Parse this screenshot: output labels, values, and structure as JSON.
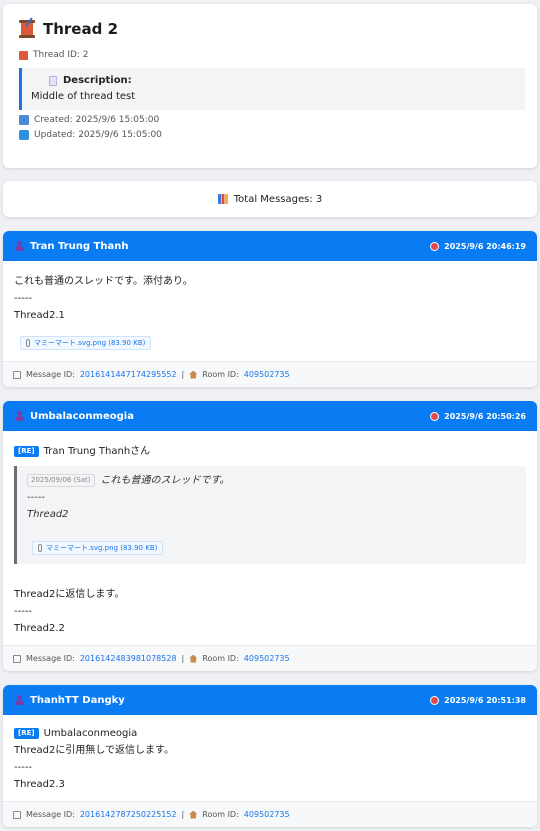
{
  "thread": {
    "title": "Thread 2",
    "id_label": "Thread ID: 2",
    "description_label": "Description:",
    "description": "Middle of thread test",
    "created": "Created: 2025/9/6 15:05:00",
    "updated": "Updated: 2025/9/6 15:05:00"
  },
  "summary": {
    "total_messages": "Total Messages: 3"
  },
  "messages": [
    {
      "author": "Tran Trung Thanh",
      "time": "2025/9/6 20:46:19",
      "lines": [
        "これも普通のスレッドです。添付あり。",
        "-----",
        "Thread2.1"
      ],
      "attachment": "マミーマート.svg.png (83.90 KB)",
      "message_id_label": "Message ID:",
      "message_id": "2016141447174295552",
      "room_id_label": "Room ID:",
      "room_id": "409502735"
    },
    {
      "author": "Umbalaconmeogia",
      "time": "2025/9/6 20:50:26",
      "re_tag": "[RE]",
      "re_to": "Tran Trung Thanhさん",
      "quote": {
        "date": "2025/09/06 (Sat)",
        "lines": [
          "これも普通のスレッドです。",
          "-----",
          "Thread2"
        ],
        "attachment": "マミーマート.svg.png (83.90 KB)"
      },
      "lines": [
        "Thread2に返信します。",
        "-----",
        "Thread2.2"
      ],
      "message_id_label": "Message ID:",
      "message_id": "2016142483981078528",
      "room_id_label": "Room ID:",
      "room_id": "409502735"
    },
    {
      "author": "ThanhTT Dangky",
      "time": "2025/9/6 20:51:38",
      "re_tag": "[RE]",
      "re_to": "Umbalaconmeogia",
      "lines": [
        "Thread2に引用無しで返信します。",
        "-----",
        "Thread2.3"
      ],
      "message_id_label": "Message ID:",
      "message_id": "2016142787250225152",
      "room_id_label": "Room ID:",
      "room_id": "409502735"
    }
  ],
  "colors": {
    "accent": "#0a7cf3",
    "link": "#1a73e8"
  }
}
